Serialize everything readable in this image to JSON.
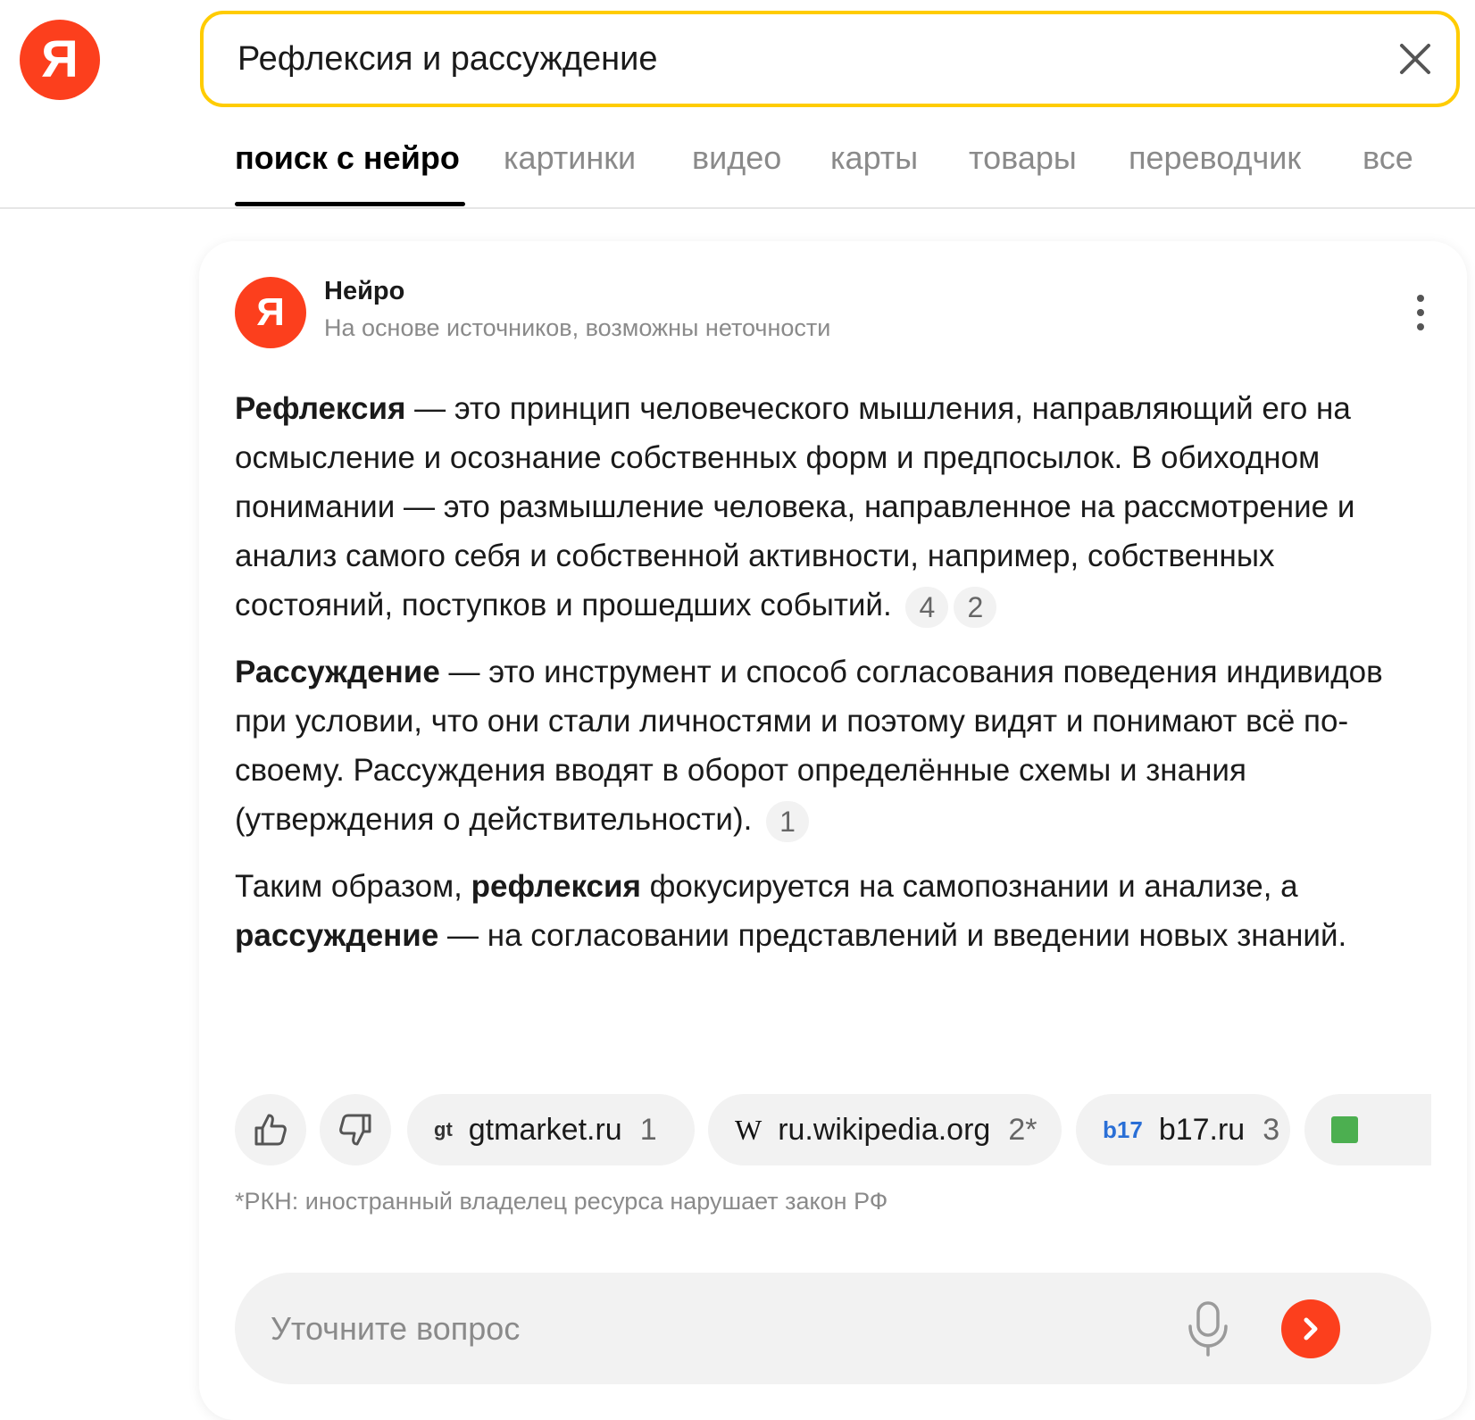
{
  "header": {
    "logo_letter": "Я",
    "search": {
      "value": "Рефлексия и рассуждение"
    }
  },
  "tabs": [
    {
      "label": "поиск с нейро",
      "active": true
    },
    {
      "label": "картинки",
      "active": false
    },
    {
      "label": "видео",
      "active": false
    },
    {
      "label": "карты",
      "active": false
    },
    {
      "label": "товары",
      "active": false
    },
    {
      "label": "переводчик",
      "active": false
    },
    {
      "label": "все",
      "active": false
    }
  ],
  "neuro": {
    "avatar_letter": "Я",
    "name": "Нейро",
    "subtitle": "На основе источников, возможны неточности",
    "paragraphs": {
      "p1": {
        "term": "Рефлексия",
        "text": " — это принцип человеческого мышления, направляющий его на осмысление и осознание собственных форм и предпосылок. В обиходном понимании — это размышление человека, направленное на рассмотрение и анализ самого себя и собственной активности, например, собственных состояний, поступков и прошедших событий.",
        "refs": [
          "4",
          "2"
        ]
      },
      "p2": {
        "term": "Рассуждение",
        "text": " — это инструмент и способ согласования поведения индивидов при условии, что они стали личностями и поэтому видят и понимают всё по-своему. Рассуждения вводят в оборот определённые схемы и знания (утверждения о действительности).",
        "refs": [
          "1"
        ]
      },
      "p3": {
        "t1": "Таким образом, ",
        "b1": "рефлексия",
        "t2": " фокусируется на самопознании и анализе, а ",
        "b2": "рассуждение",
        "t3": " — на согласовании представлений и введении новых знаний."
      }
    },
    "sources": [
      {
        "icon_text": "gt",
        "domain": "gtmarket.ru",
        "num": "1"
      },
      {
        "icon_text": "W",
        "domain": "ru.wikipedia.org",
        "num": "2*"
      },
      {
        "icon_text": "b17",
        "domain": "b17.ru",
        "num": "3"
      }
    ],
    "rkn_note": "*РКН: иностранный владелец ресурса нарушает закон РФ",
    "followup_placeholder": "Уточните вопрос"
  },
  "colors": {
    "brand": "#fc3f1d",
    "search_border": "#ffcc00",
    "b17_blue": "#2a6fd6",
    "chip_bg": "#f2f2f2"
  },
  "icons": {
    "clear": "close-icon",
    "more": "more-vertical-icon",
    "like": "thumbs-up-icon",
    "dislike": "thumbs-down-icon",
    "mic": "microphone-icon",
    "send": "arrow-right-icon"
  }
}
